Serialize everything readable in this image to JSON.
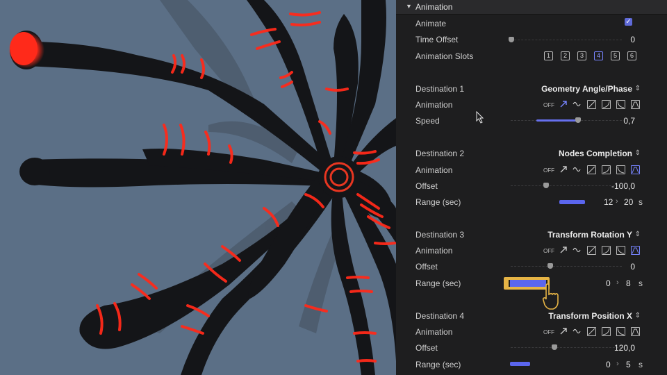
{
  "panel": {
    "section_title": "Animation",
    "animate": {
      "label": "Animate",
      "checked": true
    },
    "time_offset": {
      "label": "Time Offset",
      "value": "0"
    },
    "slots": {
      "label": "Animation Slots",
      "items": [
        "1",
        "2",
        "3",
        "4",
        "5",
        "6"
      ],
      "active": "4"
    },
    "animation_label": "Animation",
    "off_label": "OFF",
    "destinations": [
      {
        "label": "Destination 1",
        "value": "Geometry Angle/Phase",
        "active_mode": "ramp",
        "param": {
          "label": "Speed",
          "value": "0,7"
        }
      },
      {
        "label": "Destination 2",
        "value": "Nodes Completion",
        "active_mode": "peak",
        "param": {
          "label": "Offset",
          "value": "-100,0"
        },
        "range": {
          "label": "Range (sec)",
          "from": "12",
          "to": "20",
          "unit": "s"
        }
      },
      {
        "label": "Destination 3",
        "value": "Transform Rotation Y",
        "active_mode": "peak",
        "param": {
          "label": "Offset",
          "value": "0"
        },
        "range": {
          "label": "Range (sec)",
          "from": "0",
          "to": "8",
          "unit": "s"
        }
      },
      {
        "label": "Destination 4",
        "value": "Transform Position X",
        "active_mode": "none",
        "param": {
          "label": "Offset",
          "value": "120,0"
        },
        "range": {
          "label": "Range (sec)",
          "from": "0",
          "to": "5",
          "unit": "s"
        }
      }
    ],
    "accent": "#6670ee"
  },
  "viewport": {
    "background": "#5b6f86",
    "glow": "#ff2a1a"
  }
}
